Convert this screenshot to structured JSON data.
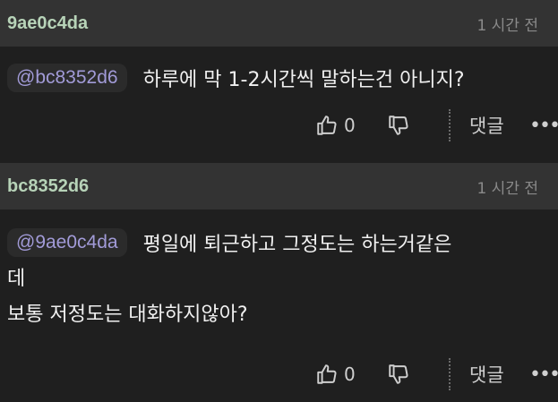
{
  "comments": [
    {
      "author": "9ae0c4da",
      "time": "1 시간 전",
      "mention": "@bc8352d6",
      "text_line1": "하루에 막 1-2시간씩 말하는건 아니지?",
      "likes": "0",
      "reply_label": "댓글",
      "more": "•••"
    },
    {
      "author": "bc8352d6",
      "time": "1 시간 전",
      "mention": "@9ae0c4da",
      "text_line1": "평일에 퇴근하고 그정도는 하는거같은",
      "text_line2": "데",
      "text_line3": "보통 저정도는 대화하지않아?",
      "likes": "0",
      "reply_label": "댓글",
      "more": "•••"
    }
  ]
}
